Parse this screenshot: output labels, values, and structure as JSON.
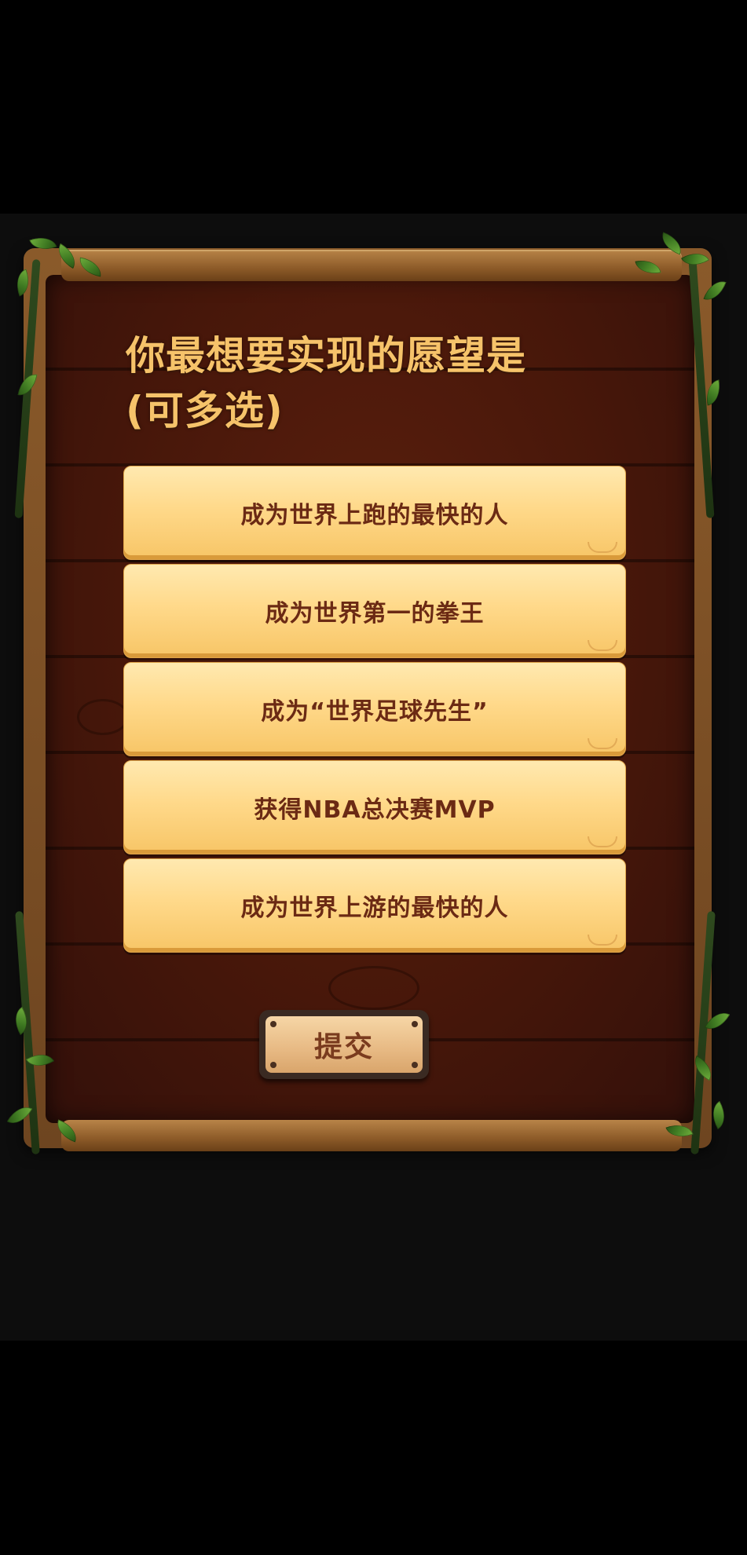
{
  "question": {
    "title": "你最想要实现的愿望是\n(可多选)"
  },
  "options": [
    {
      "label": "成为世界上跑的最快的人"
    },
    {
      "label": "成为世界第一的拳王"
    },
    {
      "label": "成为“世界足球先生”"
    },
    {
      "label": "获得NBA总决赛MVP"
    },
    {
      "label": "成为世界上游的最快的人"
    }
  ],
  "submit": {
    "label": "提交"
  },
  "colors": {
    "title": "#f6c36a",
    "option_bg": "#ffd98a",
    "option_text": "#6b2a14",
    "board_wood": "#47170a",
    "frame_wood": "#8a5a2a",
    "vine_leaf": "#3f7a22"
  }
}
